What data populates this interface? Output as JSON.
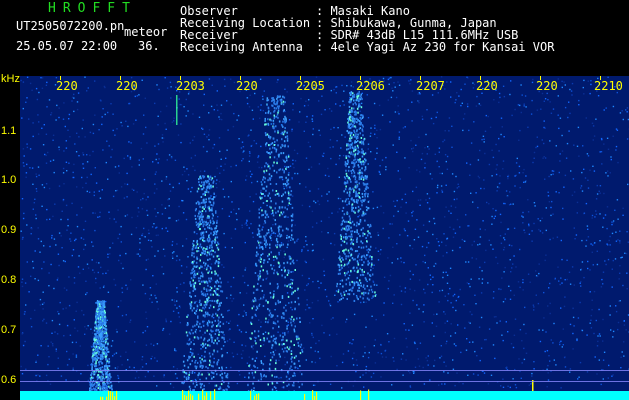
{
  "brand": "HROFFT",
  "file_name": "UT2505072200.pn",
  "meteor_label": "meteor",
  "timestamp": "25.05.07 22:00",
  "count": "36.",
  "info": {
    "rows": [
      {
        "label": "Observer",
        "value": ": Masaki Kano"
      },
      {
        "label": "Receiving Location",
        "value": ": Shibukawa, Gunma, Japan"
      },
      {
        "label": "Receiver",
        "value": ": SDR# 43dB L15 111.6MHz USB"
      },
      {
        "label": "Receiving Antenna",
        "value": ": 4ele Yagi Az 230 for Kansai VOR"
      }
    ]
  },
  "axis": {
    "unit": "kHz",
    "y_ticks": [
      "1.1",
      "1.0",
      "0.9",
      "0.8",
      "0.7",
      "0.6"
    ],
    "x_ticks": [
      "220",
      "220",
      "2203",
      "220",
      "2205",
      "2206",
      "2207",
      "220",
      "220",
      "2210"
    ]
  },
  "colors": {
    "background": "#000000",
    "spectrum_base": "#001a6e",
    "noise_floor": "#00ffff",
    "burst": "#ffff00",
    "grid": "#8888ff"
  }
}
